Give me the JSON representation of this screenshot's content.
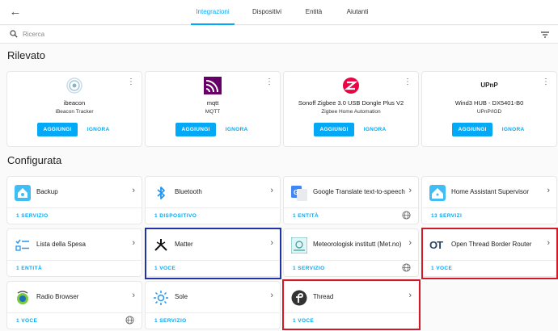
{
  "nav": {
    "tabs": [
      {
        "label": "Integrazioni"
      },
      {
        "label": "Dispositivi"
      },
      {
        "label": "Entità"
      },
      {
        "label": "Aiutanti"
      }
    ]
  },
  "search": {
    "placeholder": "Ricerca"
  },
  "discovered": {
    "title": "Rilevato",
    "items": [
      {
        "name": "ibeacon",
        "sub": "iBeacon Tracker",
        "add": "AGGIUNGI",
        "ignore": "IGNORA",
        "logo": "ibeacon-icon"
      },
      {
        "name": "mqtt",
        "sub": "MQTT",
        "add": "AGGIUNGI",
        "ignore": "IGNORA",
        "logo": "mqtt-icon"
      },
      {
        "name": "Sonoff Zigbee 3.0 USB Dongle Plus V2",
        "sub": "Zigbee Home Automation",
        "add": "AGGIUNGI",
        "ignore": "IGNORA",
        "logo": "zigbee-icon"
      },
      {
        "name": "Wind3 HUB - DX5401-B0",
        "sub": "UPnP/IGD",
        "add": "AGGIUNGI",
        "ignore": "IGNORA",
        "logo": "upnp-icon",
        "logo_text": "UPnP"
      }
    ]
  },
  "configured": {
    "title": "Configurata",
    "items": [
      {
        "title": "Backup",
        "footer": "1 SERVIZIO",
        "icon": "backup-icon"
      },
      {
        "title": "Bluetooth",
        "footer": "1 DISPOSITIVO",
        "icon": "bluetooth-icon"
      },
      {
        "title": "Google Translate text-to-speech",
        "footer": "1 ENTITÀ",
        "icon": "google-translate-icon",
        "cloud": true
      },
      {
        "title": "Home Assistant Supervisor",
        "footer": "13 SERVIZI",
        "icon": "home-assistant-icon"
      },
      {
        "title": "Lista della Spesa",
        "footer": "1 ENTITÀ",
        "icon": "shopping-list-icon"
      },
      {
        "title": "Matter",
        "footer": "1 VOCE",
        "icon": "matter-icon"
      },
      {
        "title": "Meteorologisk institutt (Met.no)",
        "footer": "1 SERVIZIO",
        "icon": "met-no-icon",
        "cloud": true
      },
      {
        "title": "Open Thread Border Router",
        "footer": "1 VOCE",
        "icon": "otbr-icon",
        "icon_text": "OT"
      },
      {
        "title": "Radio Browser",
        "footer": "1 VOCE",
        "icon": "radio-browser-icon",
        "cloud": true
      },
      {
        "title": "Sole",
        "footer": "1 SERVIZIO",
        "icon": "sun-icon"
      },
      {
        "title": "Thread",
        "footer": "1 VOCE",
        "icon": "thread-icon"
      }
    ]
  },
  "colors": {
    "accent": "#03a9f4",
    "highlight_blue": "#2233aa",
    "highlight_red": "#d01a28"
  }
}
